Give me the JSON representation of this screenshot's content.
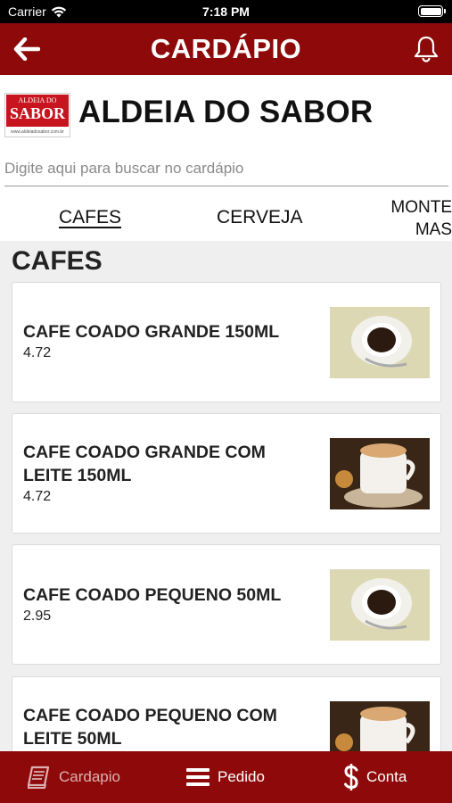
{
  "status": {
    "carrier": "Carrier",
    "time": "7:18 PM"
  },
  "header": {
    "title": "CARDÁPIO"
  },
  "brand": {
    "name": "ALDEIA DO SABOR",
    "logo_line1": "ALDEIA DO",
    "logo_line2": "SABOR",
    "logo_url": "www.aldeiadosabor.com.br"
  },
  "search": {
    "placeholder": "Digite aqui para buscar no cardápio"
  },
  "tabs": [
    {
      "label": "CAFES"
    },
    {
      "label": "CERVEJA"
    },
    {
      "label_line1": "MONTE",
      "label_line2": "MAS"
    }
  ],
  "section": {
    "title": "CAFES"
  },
  "items": [
    {
      "name": "CAFE COADO GRANDE 150ML",
      "price": "4.72"
    },
    {
      "name": "CAFE COADO GRANDE COM LEITE 150ML",
      "price": "4.72"
    },
    {
      "name": "CAFE COADO PEQUENO 50ML",
      "price": "2.95"
    },
    {
      "name": "CAFE COADO PEQUENO COM LEITE 50ML",
      "price": ""
    }
  ],
  "tabbar": [
    {
      "label": "Cardapio",
      "icon": "book-icon"
    },
    {
      "label": "Pedido",
      "icon": "menu-lines-icon"
    },
    {
      "label": "Conta",
      "icon": "dollar-icon"
    }
  ],
  "colors": {
    "primary": "#8e0a0a",
    "background": "#efefef"
  }
}
